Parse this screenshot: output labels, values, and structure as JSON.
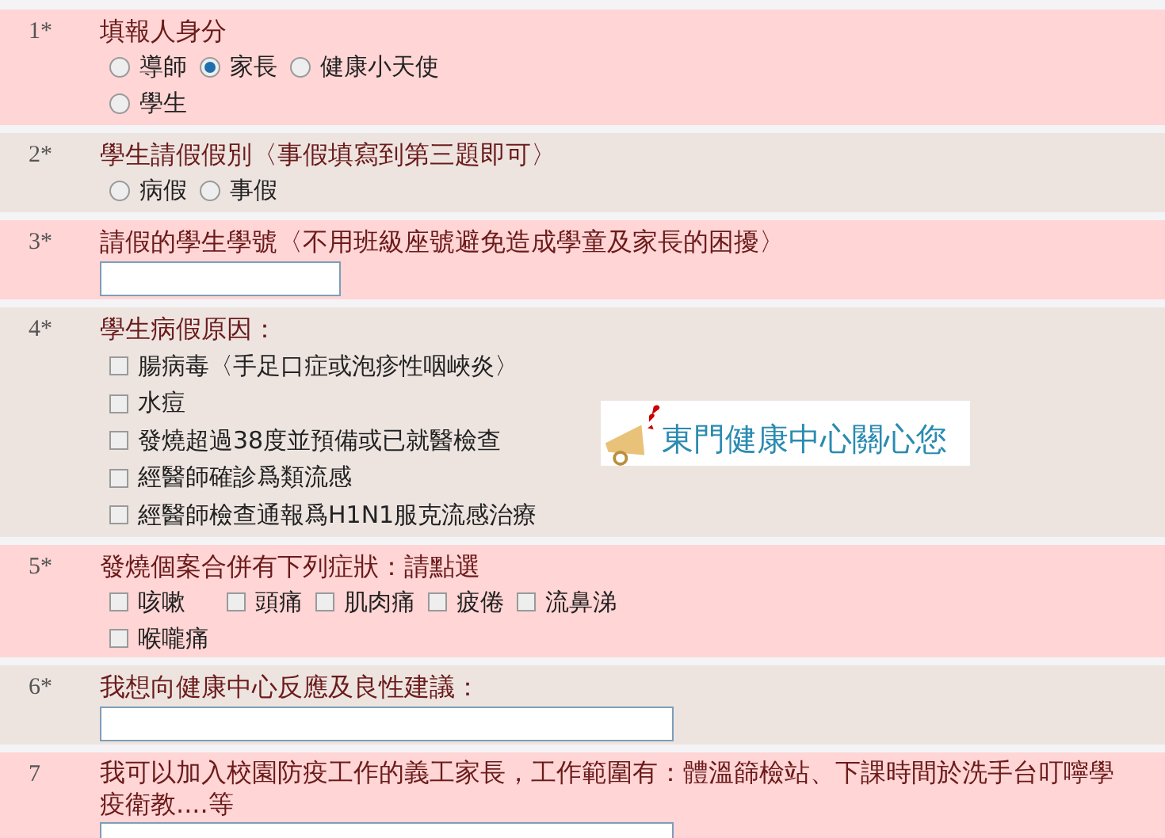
{
  "questions": [
    {
      "number": "1*",
      "text": "填報人身分",
      "kind": "radio",
      "options": [
        {
          "label": "導師",
          "selected": false
        },
        {
          "label": "家長",
          "selected": true
        },
        {
          "label": "健康小天使",
          "selected": false
        },
        {
          "label": "學生",
          "selected": false
        }
      ]
    },
    {
      "number": "2*",
      "text": "學生請假假別〈事假填寫到第三題即可〉",
      "kind": "radio",
      "options": [
        {
          "label": "病假",
          "selected": false
        },
        {
          "label": "事假",
          "selected": false
        }
      ]
    },
    {
      "number": "3*",
      "text": "請假的學生學號〈不用班級座號避免造成學童及家長的困擾〉",
      "kind": "short_text"
    },
    {
      "number": "4*",
      "text": "學生病假原因：",
      "kind": "checkbox_list",
      "banner": "東門健康中心關心您",
      "options": [
        {
          "label": "腸病毒〈手足口症或泡疹性咽峽炎〉",
          "checked": false
        },
        {
          "label": "水痘",
          "checked": false
        },
        {
          "label": "發燒超過38度並預備或已就醫檢查",
          "checked": false
        },
        {
          "label": "經醫師確診爲類流感",
          "checked": false
        },
        {
          "label": "經醫師檢查通報爲H1N1服克流感治療",
          "checked": false
        }
      ]
    },
    {
      "number": "5*",
      "text": "發燒個案合併有下列症狀：請點選",
      "kind": "checkbox_inline",
      "options": [
        {
          "label": "咳嗽",
          "checked": false
        },
        {
          "label": "頭痛",
          "checked": false
        },
        {
          "label": "肌肉痛",
          "checked": false
        },
        {
          "label": "疲倦",
          "checked": false
        },
        {
          "label": "流鼻涕",
          "checked": false
        },
        {
          "label": "喉嚨痛",
          "checked": false
        }
      ]
    },
    {
      "number": "6*",
      "text": "我想向健康中心反應及良性建議：",
      "kind": "long_text"
    },
    {
      "number": "7",
      "lines": [
        "我可以加入校園防疫工作的義工家長，工作範圍有：體溫篩檢站、下課時間於洗手台叮嚀學",
        "疫衛教....等"
      ],
      "kind": "long_text"
    }
  ]
}
